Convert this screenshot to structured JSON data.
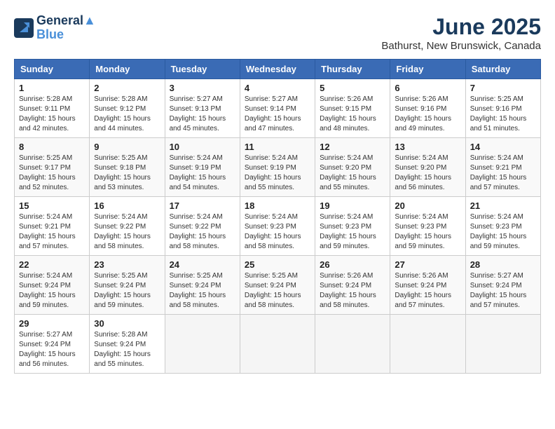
{
  "logo": {
    "line1": "General",
    "line2": "Blue"
  },
  "title": "June 2025",
  "location": "Bathurst, New Brunswick, Canada",
  "weekdays": [
    "Sunday",
    "Monday",
    "Tuesday",
    "Wednesday",
    "Thursday",
    "Friday",
    "Saturday"
  ],
  "weeks": [
    [
      {
        "day": "1",
        "sunrise": "5:28 AM",
        "sunset": "9:11 PM",
        "daylight": "15 hours and 42 minutes."
      },
      {
        "day": "2",
        "sunrise": "5:28 AM",
        "sunset": "9:12 PM",
        "daylight": "15 hours and 44 minutes."
      },
      {
        "day": "3",
        "sunrise": "5:27 AM",
        "sunset": "9:13 PM",
        "daylight": "15 hours and 45 minutes."
      },
      {
        "day": "4",
        "sunrise": "5:27 AM",
        "sunset": "9:14 PM",
        "daylight": "15 hours and 47 minutes."
      },
      {
        "day": "5",
        "sunrise": "5:26 AM",
        "sunset": "9:15 PM",
        "daylight": "15 hours and 48 minutes."
      },
      {
        "day": "6",
        "sunrise": "5:26 AM",
        "sunset": "9:16 PM",
        "daylight": "15 hours and 49 minutes."
      },
      {
        "day": "7",
        "sunrise": "5:25 AM",
        "sunset": "9:16 PM",
        "daylight": "15 hours and 51 minutes."
      }
    ],
    [
      {
        "day": "8",
        "sunrise": "5:25 AM",
        "sunset": "9:17 PM",
        "daylight": "15 hours and 52 minutes."
      },
      {
        "day": "9",
        "sunrise": "5:25 AM",
        "sunset": "9:18 PM",
        "daylight": "15 hours and 53 minutes."
      },
      {
        "day": "10",
        "sunrise": "5:24 AM",
        "sunset": "9:19 PM",
        "daylight": "15 hours and 54 minutes."
      },
      {
        "day": "11",
        "sunrise": "5:24 AM",
        "sunset": "9:19 PM",
        "daylight": "15 hours and 55 minutes."
      },
      {
        "day": "12",
        "sunrise": "5:24 AM",
        "sunset": "9:20 PM",
        "daylight": "15 hours and 55 minutes."
      },
      {
        "day": "13",
        "sunrise": "5:24 AM",
        "sunset": "9:20 PM",
        "daylight": "15 hours and 56 minutes."
      },
      {
        "day": "14",
        "sunrise": "5:24 AM",
        "sunset": "9:21 PM",
        "daylight": "15 hours and 57 minutes."
      }
    ],
    [
      {
        "day": "15",
        "sunrise": "5:24 AM",
        "sunset": "9:21 PM",
        "daylight": "15 hours and 57 minutes."
      },
      {
        "day": "16",
        "sunrise": "5:24 AM",
        "sunset": "9:22 PM",
        "daylight": "15 hours and 58 minutes."
      },
      {
        "day": "17",
        "sunrise": "5:24 AM",
        "sunset": "9:22 PM",
        "daylight": "15 hours and 58 minutes."
      },
      {
        "day": "18",
        "sunrise": "5:24 AM",
        "sunset": "9:23 PM",
        "daylight": "15 hours and 58 minutes."
      },
      {
        "day": "19",
        "sunrise": "5:24 AM",
        "sunset": "9:23 PM",
        "daylight": "15 hours and 59 minutes."
      },
      {
        "day": "20",
        "sunrise": "5:24 AM",
        "sunset": "9:23 PM",
        "daylight": "15 hours and 59 minutes."
      },
      {
        "day": "21",
        "sunrise": "5:24 AM",
        "sunset": "9:23 PM",
        "daylight": "15 hours and 59 minutes."
      }
    ],
    [
      {
        "day": "22",
        "sunrise": "5:24 AM",
        "sunset": "9:24 PM",
        "daylight": "15 hours and 59 minutes."
      },
      {
        "day": "23",
        "sunrise": "5:25 AM",
        "sunset": "9:24 PM",
        "daylight": "15 hours and 59 minutes."
      },
      {
        "day": "24",
        "sunrise": "5:25 AM",
        "sunset": "9:24 PM",
        "daylight": "15 hours and 58 minutes."
      },
      {
        "day": "25",
        "sunrise": "5:25 AM",
        "sunset": "9:24 PM",
        "daylight": "15 hours and 58 minutes."
      },
      {
        "day": "26",
        "sunrise": "5:26 AM",
        "sunset": "9:24 PM",
        "daylight": "15 hours and 58 minutes."
      },
      {
        "day": "27",
        "sunrise": "5:26 AM",
        "sunset": "9:24 PM",
        "daylight": "15 hours and 57 minutes."
      },
      {
        "day": "28",
        "sunrise": "5:27 AM",
        "sunset": "9:24 PM",
        "daylight": "15 hours and 57 minutes."
      }
    ],
    [
      {
        "day": "29",
        "sunrise": "5:27 AM",
        "sunset": "9:24 PM",
        "daylight": "15 hours and 56 minutes."
      },
      {
        "day": "30",
        "sunrise": "5:28 AM",
        "sunset": "9:24 PM",
        "daylight": "15 hours and 55 minutes."
      },
      null,
      null,
      null,
      null,
      null
    ]
  ],
  "labels": {
    "sunrise": "Sunrise:",
    "sunset": "Sunset:",
    "daylight": "Daylight:"
  }
}
